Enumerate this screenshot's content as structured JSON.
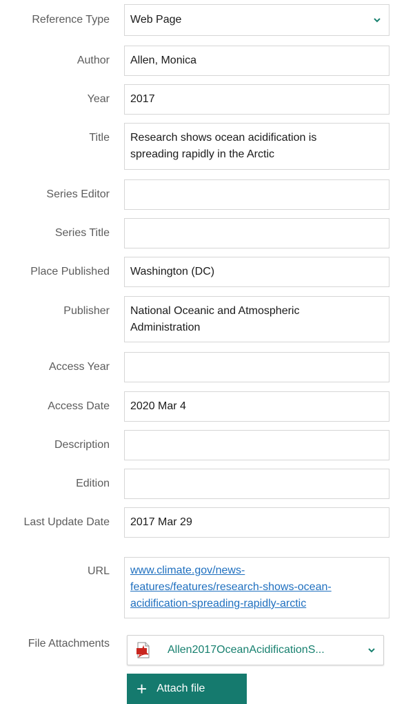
{
  "form": {
    "reference_type": {
      "label": "Reference Type",
      "value": "Web Page"
    },
    "author": {
      "label": "Author",
      "value": "Allen, Monica"
    },
    "year": {
      "label": "Year",
      "value": "2017"
    },
    "title": {
      "label": "Title",
      "line1": "Research shows ocean acidification is",
      "line2": "spreading rapidly in the Arctic"
    },
    "series_editor": {
      "label": "Series Editor",
      "value": ""
    },
    "series_title": {
      "label": "Series Title",
      "value": ""
    },
    "place_published": {
      "label": "Place Published",
      "value": "Washington (DC)"
    },
    "publisher": {
      "label": "Publisher",
      "line1": "National Oceanic and Atmospheric",
      "line2": "Administration"
    },
    "access_year": {
      "label": "Access Year",
      "value": ""
    },
    "access_date": {
      "label": "Access Date",
      "value": "2020 Mar 4"
    },
    "description": {
      "label": "Description",
      "value": ""
    },
    "edition": {
      "label": "Edition",
      "value": ""
    },
    "last_update_date": {
      "label": "Last Update Date",
      "value": "2017 Mar 29"
    },
    "url": {
      "label": "URL",
      "line1": "www.climate.gov/news-",
      "line2": "features/features/research-shows-ocean-",
      "line3": "acidification-spreading-rapidly-arctic"
    },
    "file_attachments": {
      "label": "File Attachments",
      "file_name": "Allen2017OceanAcidificationS...",
      "attach_label": "Attach file"
    }
  },
  "colors": {
    "accent": "#157a6e",
    "link": "#1e6fbf",
    "chevron": "#17806f"
  },
  "icons": {
    "dropdown": "chevron-down-icon",
    "pdf": "pdf-file-icon",
    "add": "plus-icon"
  }
}
